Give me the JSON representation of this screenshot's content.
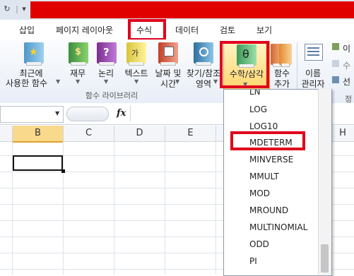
{
  "colors": {
    "highlight": "#e0001c",
    "selected_col": "#f9d98b"
  },
  "tabs": [
    {
      "label": "삽입"
    },
    {
      "label": "페이지 레이아웃"
    },
    {
      "label": "수식"
    },
    {
      "label": "데이터"
    },
    {
      "label": "검토"
    },
    {
      "label": "보기"
    }
  ],
  "ribbon": {
    "recent": {
      "line1": "최근에",
      "line2": "사용한 함수",
      "icon": "star-book-icon"
    },
    "finance": {
      "line1": "재무",
      "icon": "money-book-icon"
    },
    "logic": {
      "line1": "논리",
      "icon": "question-book-icon"
    },
    "text": {
      "line1": "텍스트",
      "icon": "text-book-icon"
    },
    "date": {
      "line1": "날짜 및",
      "line2": "시간",
      "icon": "calendar-book-icon"
    },
    "lookup": {
      "line1": "찾기/참조",
      "line2": "영역",
      "icon": "search-book-icon"
    },
    "math": {
      "line1": "수학/삼각",
      "symbol": "θ",
      "icon": "theta-book-icon"
    },
    "more": {
      "line1": "함수",
      "line2": "추가",
      "icon": "more-books-icon"
    },
    "name_mgr": {
      "line1": "이름",
      "line2": "관리자",
      "icon": "name-manager-icon"
    },
    "small_labels": [
      "이",
      "수",
      "선"
    ],
    "group_label": "함수 라이브러리",
    "group_label_right": "정"
  },
  "formula_bar": {
    "fx": "fx"
  },
  "columns": [
    "B",
    "C",
    "D",
    "E",
    "H"
  ],
  "dropdown": {
    "items": [
      "LN",
      "LOG",
      "LOG10",
      "MDETERM",
      "MINVERSE",
      "MMULT",
      "MOD",
      "MROUND",
      "MULTINOMIAL",
      "ODD",
      "PI"
    ],
    "highlighted": "MDETERM"
  }
}
